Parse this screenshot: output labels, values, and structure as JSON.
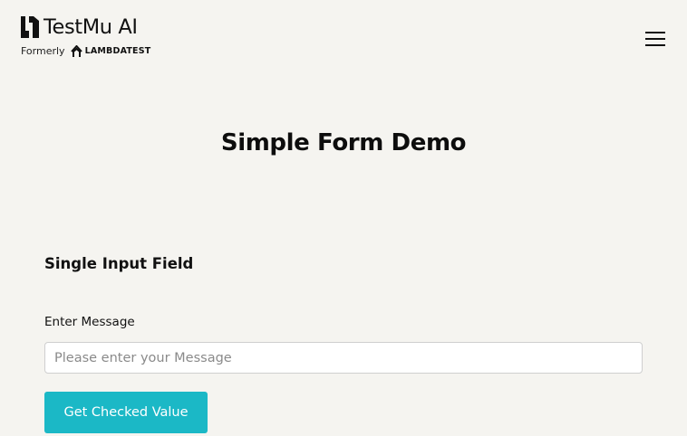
{
  "header": {
    "brand_name": "TestMu AI",
    "formerly_label": "Formerly",
    "former_brand": "LAMBDATEST",
    "logo_icon": "testmu-logo-icon",
    "former_brand_icon": "lambdatest-logo-icon",
    "menu_icon": "hamburger-menu-icon"
  },
  "page": {
    "title": "Simple Form Demo"
  },
  "single_input": {
    "heading": "Single Input Field",
    "label": "Enter Message",
    "placeholder": "Please enter your Message",
    "value": "",
    "button_label": "Get Checked Value"
  },
  "colors": {
    "background": "#f5f4f0",
    "accent": "#1bb8c6",
    "text": "#111111",
    "input_border": "#cfcfcf"
  }
}
